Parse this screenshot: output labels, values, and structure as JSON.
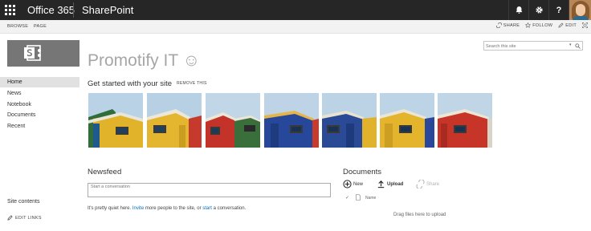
{
  "suite_bar": {
    "brand": "Office 365",
    "app": "SharePoint",
    "icons": [
      "app-launcher-icon",
      "bell-icon",
      "gear-icon",
      "help-icon"
    ]
  },
  "ribbon": {
    "tabs": [
      "BROWSE",
      "PAGE"
    ],
    "actions": {
      "share": "SHARE",
      "follow": "FOLLOW",
      "edit": "EDIT"
    }
  },
  "site": {
    "title": "Promotify IT ☺"
  },
  "search": {
    "placeholder": "Search this site"
  },
  "left_nav": {
    "items": [
      "Home",
      "News",
      "Notebook",
      "Documents",
      "Recent"
    ],
    "selected": "Home",
    "site_contents": "Site contents",
    "edit_links": "EDIT LINKS"
  },
  "get_started": {
    "title": "Get started with your site",
    "remove_label": "REMOVE THIS",
    "tile_count": 7
  },
  "newsfeed": {
    "title": "Newsfeed",
    "input_placeholder": "Start a conversation",
    "quiet_prefix": "It's pretty quiet here. ",
    "invite_link": "Invite",
    "quiet_middle": " more people to the site, or ",
    "start_link": "start",
    "quiet_suffix": " a conversation."
  },
  "documents": {
    "title": "Documents",
    "new_label": "New",
    "upload_label": "Upload",
    "share_label": "Share",
    "column_name": "Name",
    "drag_hint": "Drag files here to upload"
  },
  "colors": {
    "suite_bar": "#262626",
    "link": "#0072c6",
    "title_gray": "#a6a6a6"
  }
}
